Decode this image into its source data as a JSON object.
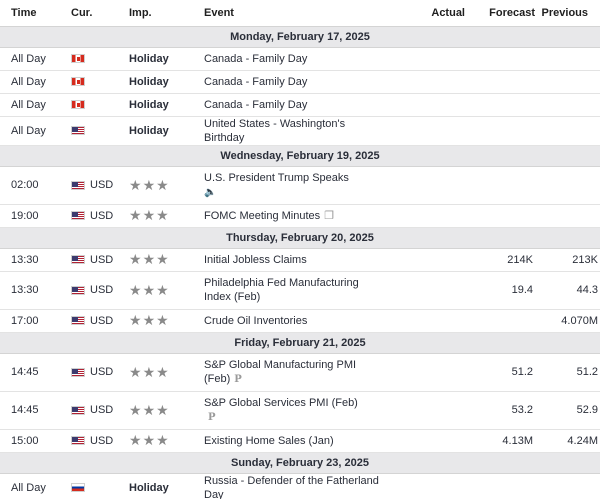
{
  "headers": {
    "time": "Time",
    "cur": "Cur.",
    "imp": "Imp.",
    "event": "Event",
    "actual": "Actual",
    "forecast": "Forecast",
    "previous": "Previous"
  },
  "dates": [
    "Monday, February 17, 2025",
    "Wednesday, February 19, 2025",
    "Thursday, February 20, 2025",
    "Friday, February 21, 2025",
    "Sunday, February 23, 2025"
  ],
  "events": [
    {
      "time": "All Day",
      "flag": "ca",
      "currency": "",
      "importance": "Holiday",
      "event": "Canada - Family Day",
      "actual": "",
      "forecast": "",
      "previous": ""
    },
    {
      "time": "All Day",
      "flag": "ca",
      "currency": "",
      "importance": "Holiday",
      "event": "Canada - Family Day",
      "actual": "",
      "forecast": "",
      "previous": ""
    },
    {
      "time": "All Day",
      "flag": "ca",
      "currency": "",
      "importance": "Holiday",
      "event": "Canada - Family Day",
      "actual": "",
      "forecast": "",
      "previous": ""
    },
    {
      "time": "All Day",
      "flag": "us",
      "currency": "",
      "importance": "Holiday",
      "event": "United States - Washington's Birthday",
      "actual": "",
      "forecast": "",
      "previous": ""
    },
    {
      "time": "02:00",
      "flag": "us",
      "currency": "USD",
      "stars": 3,
      "event": "U.S. President Trump Speaks",
      "icon": "speaker-icon",
      "actual": "",
      "forecast": "",
      "previous": ""
    },
    {
      "time": "19:00",
      "flag": "us",
      "currency": "USD",
      "stars": 3,
      "event": "FOMC Meeting Minutes",
      "icon": "document-icon",
      "actual": "",
      "forecast": "",
      "previous": ""
    },
    {
      "time": "13:30",
      "flag": "us",
      "currency": "USD",
      "stars": 3,
      "event": "Initial Jobless Claims",
      "actual": "",
      "forecast": "214K",
      "previous": "213K"
    },
    {
      "time": "13:30",
      "flag": "us",
      "currency": "USD",
      "stars": 3,
      "event": "Philadelphia Fed Manufacturing Index (Feb)",
      "actual": "",
      "forecast": "19.4",
      "previous": "44.3"
    },
    {
      "time": "17:00",
      "flag": "us",
      "currency": "USD",
      "stars": 3,
      "event": "Crude Oil Inventories",
      "actual": "",
      "forecast": "",
      "previous": "4.070M"
    },
    {
      "time": "14:45",
      "flag": "us",
      "currency": "USD",
      "stars": 3,
      "event": "S&P Global Manufacturing PMI (Feb)",
      "icon": "preliminary-icon",
      "actual": "",
      "forecast": "51.2",
      "previous": "51.2"
    },
    {
      "time": "14:45",
      "flag": "us",
      "currency": "USD",
      "stars": 3,
      "event": "S&P Global Services PMI (Feb)",
      "icon": "preliminary-icon",
      "actual": "",
      "forecast": "53.2",
      "previous": "52.9"
    },
    {
      "time": "15:00",
      "flag": "us",
      "currency": "USD",
      "stars": 3,
      "event": "Existing Home Sales (Jan)",
      "actual": "",
      "forecast": "4.13M",
      "previous": "4.24M"
    },
    {
      "time": "All Day",
      "flag": "ru",
      "currency": "",
      "importance": "Holiday",
      "event": "Russia - Defender of the Fatherland Day",
      "actual": "",
      "forecast": "",
      "previous": ""
    }
  ],
  "icons": {
    "speaker-icon": "🔈",
    "document-icon": "❐",
    "preliminary-icon": "P",
    "star": "★"
  },
  "colors": {
    "date_header_bg": "#e8e8ea",
    "star": "#8a8a8a"
  }
}
